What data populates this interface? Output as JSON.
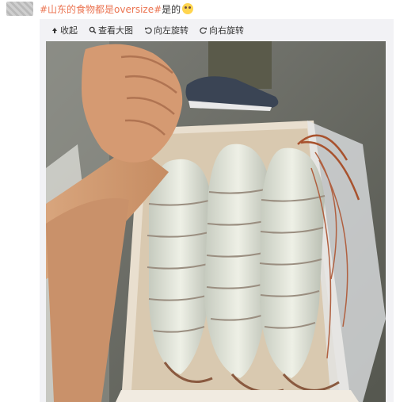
{
  "post": {
    "hashtag": "#山东的食物都是oversize#",
    "text": "是的",
    "emoji_icon": "cat-face-icon"
  },
  "toolbar": {
    "collapse_label": "收起",
    "view_large_label": "查看大图",
    "rotate_left_label": "向左旋转",
    "rotate_right_label": "向右旋转"
  },
  "icons": {
    "collapse": "collapse-arrow-icon",
    "view_large": "magnifier-icon",
    "rotate_left": "rotate-left-icon",
    "rotate_right": "rotate-right-icon"
  },
  "colors": {
    "hashtag": "#eb7350",
    "toolbar_bg": "#f2f2f5"
  }
}
